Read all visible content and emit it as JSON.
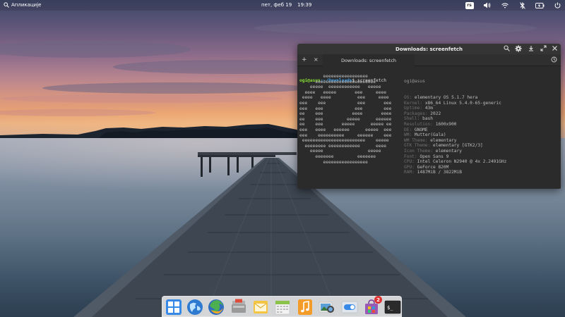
{
  "top_panel": {
    "applications_label": "Апликације",
    "date": "пет, феб 19",
    "time": "19:39",
    "keyboard_layout": "rs"
  },
  "terminal": {
    "window_title": "Downloads: screenfetch",
    "tab_label": "Downloads: screenfetch",
    "prompt_user": "ogi@asus",
    "prompt_path": ":~/Downloads",
    "prompt_symbol": "$ ",
    "command": "screenfetch",
    "logo_lines": [
      "         eeeeeeeeeeeeeeeee",
      "      eeeeeeeeeeeeeeeeeeeeeee",
      "    eeeee  eeeeeeeeeeee   eeeee",
      "  eeee   eeeee       eee     eeee",
      " eeee   eeee          eee     eeee",
      "eee    eee            eee       eee",
      "eee   eee            eee        eee",
      "ee    eee           eeee       eeee",
      "ee    eee         eeeee      eeeeee",
      "ee    eee       eeeee      eeeee ee",
      "eee   eeee   eeeeee      eeeee  eee",
      "eee    eeeeeeeeee     eeeeee    eee",
      " eeeeeeeeeeeeeeeeeeeeeeee    eeeee",
      "  eeeeeeee eeeeeeeeeeee      eeee",
      "    eeeee                 eeeee",
      "      eeeeeee         eeeeeee",
      "         eeeeeeeeeeeeeeeee"
    ],
    "info_header": "ogi@asus",
    "info": [
      {
        "key": "OS:",
        "value": "elementary OS 5.1.7 hera"
      },
      {
        "key": "Kernel:",
        "value": "x86_64 Linux 5.4.0-65-generic"
      },
      {
        "key": "Uptime:",
        "value": "43m"
      },
      {
        "key": "Packages:",
        "value": "2022"
      },
      {
        "key": "Shell:",
        "value": "bash"
      },
      {
        "key": "Resolution:",
        "value": "1600x900"
      },
      {
        "key": "DE:",
        "value": "GNOME"
      },
      {
        "key": "WM:",
        "value": "Mutter(Gala)"
      },
      {
        "key": "WM Theme:",
        "value": "elementary"
      },
      {
        "key": "GTK Theme:",
        "value": "elementary [GTK2/3]"
      },
      {
        "key": "Icon Theme:",
        "value": "elementary"
      },
      {
        "key": "Font:",
        "value": "Open Sans 9"
      },
      {
        "key": "CPU:",
        "value": "Intel Celeron N2940 @ 4x 2.2491GHz"
      },
      {
        "key": "GPU:",
        "value": "GeForce 820M"
      },
      {
        "key": "RAM:",
        "value": "1487MiB / 3822MiB"
      }
    ]
  },
  "dock": {
    "items": [
      {
        "icon": "multitasking-view-icon"
      },
      {
        "icon": "web-browser-icon"
      },
      {
        "icon": "firefox-icon"
      },
      {
        "icon": "files-icon"
      },
      {
        "icon": "mail-icon"
      },
      {
        "icon": "calendar-icon"
      },
      {
        "icon": "music-icon"
      },
      {
        "icon": "photos-icon"
      },
      {
        "icon": "settings-toggle-icon"
      },
      {
        "icon": "appcenter-icon",
        "badge": "2"
      },
      {
        "icon": "terminal-icon"
      }
    ]
  },
  "colors": {
    "accent_blue": "#3b9ee9",
    "prompt_green": "#8ae234",
    "badge_red": "#dd3333"
  }
}
